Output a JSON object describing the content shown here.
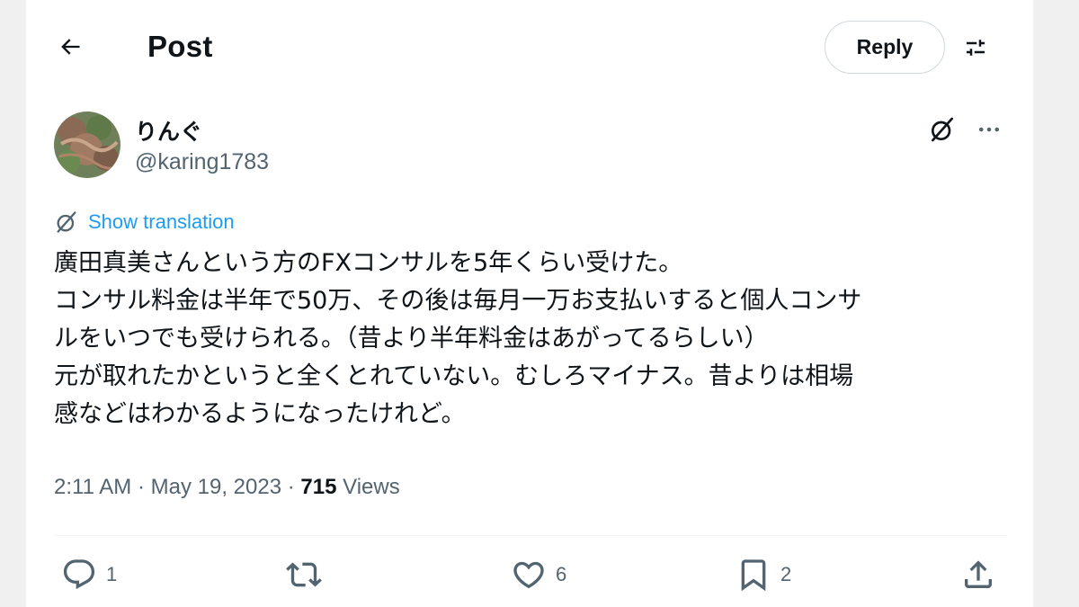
{
  "header": {
    "title": "Post",
    "reply_label": "Reply"
  },
  "author": {
    "display_name": "りんぐ",
    "handle": "@karing1783"
  },
  "translation": {
    "label": "Show translation"
  },
  "tweet": {
    "lines": [
      "廣田真美さんという方のFXコンサルを5年くらい受けた。",
      "コンサル料金は半年で50万、その後は毎月一万お支払いすると個人コンサ",
      "ルをいつでも受けられる。（昔より半年料金はあがってるらしい）",
      "元が取れたかというと全くとれていない。むしろマイナス。昔よりは相場",
      "感などはわかるようになったけれど。"
    ]
  },
  "meta": {
    "time": "2:11 AM",
    "date": "May 19, 2023",
    "views_count": "715",
    "views_label": "Views",
    "separator": "·"
  },
  "actions": {
    "replies": "1",
    "reposts": "",
    "likes": "6",
    "bookmarks": "2"
  },
  "icons": {
    "back": "arrow-left-icon",
    "filter": "sliders-icon",
    "grok": "grok-icon",
    "more": "more-horizontal-icon",
    "translate": "globe-slash-icon",
    "reply": "comment-icon",
    "repost": "repost-icon",
    "like": "heart-icon",
    "bookmark": "bookmark-icon",
    "share": "share-icon"
  },
  "colors": {
    "link": "#1d9bf0",
    "secondary_text": "#536471",
    "primary_text": "#0f1419"
  }
}
